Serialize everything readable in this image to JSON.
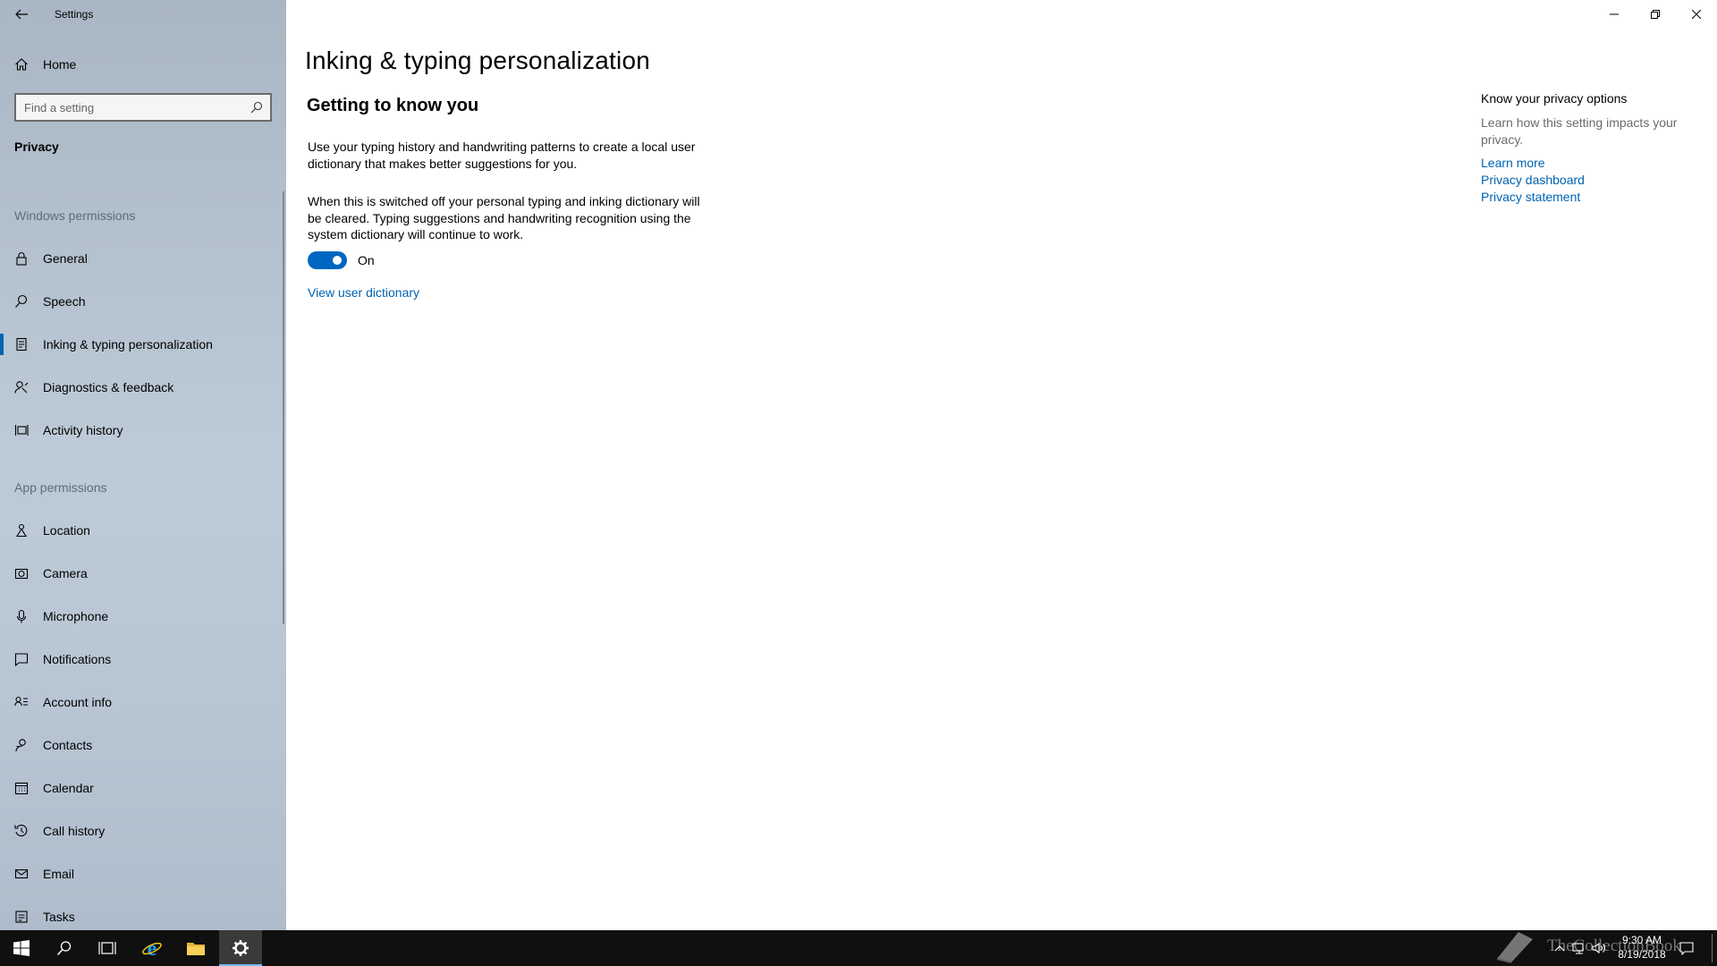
{
  "window": {
    "app_title": "Settings",
    "controls": [
      "minimize-icon",
      "restore-icon",
      "close-icon"
    ]
  },
  "sidebar": {
    "home_label": "Home",
    "search_placeholder": "Find a setting",
    "category": "Privacy",
    "windows_permissions_header": "Windows permissions",
    "windows_permissions": [
      {
        "label": "General",
        "icon": "lock-icon"
      },
      {
        "label": "Speech",
        "icon": "speech-icon"
      },
      {
        "label": "Inking & typing personalization",
        "icon": "inking-icon",
        "selected": true
      },
      {
        "label": "Diagnostics & feedback",
        "icon": "feedback-icon"
      },
      {
        "label": "Activity history",
        "icon": "activity-icon"
      }
    ],
    "app_permissions_header": "App permissions",
    "app_permissions": [
      {
        "label": "Location",
        "icon": "location-icon"
      },
      {
        "label": "Camera",
        "icon": "camera-icon"
      },
      {
        "label": "Microphone",
        "icon": "microphone-icon"
      },
      {
        "label": "Notifications",
        "icon": "notifications-icon"
      },
      {
        "label": "Account info",
        "icon": "account-info-icon"
      },
      {
        "label": "Contacts",
        "icon": "contacts-icon"
      },
      {
        "label": "Calendar",
        "icon": "calendar-icon"
      },
      {
        "label": "Call history",
        "icon": "call-history-icon"
      },
      {
        "label": "Email",
        "icon": "email-icon"
      },
      {
        "label": "Tasks",
        "icon": "tasks-icon"
      }
    ]
  },
  "main": {
    "title": "Inking & typing personalization",
    "section_title": "Getting to know you",
    "description": "Use your typing history and handwriting patterns to create a local user dictionary that makes better suggestions for you.",
    "switch_note": "When this is switched off your personal typing and inking dictionary will be cleared. Typing suggestions and handwriting recognition using the system dictionary will continue to work.",
    "toggle_state": "On",
    "toggle_on": true,
    "view_dictionary_link": "View user dictionary"
  },
  "right_panel": {
    "title": "Know your privacy options",
    "description": "Learn how this setting impacts your privacy.",
    "links": [
      "Learn more",
      "Privacy dashboard",
      "Privacy statement"
    ]
  },
  "taskbar": {
    "icons": [
      "windows-start-icon",
      "search-icon",
      "task-view-icon",
      "internet-explorer-icon",
      "file-explorer-icon",
      "settings-gear-icon"
    ],
    "active": "settings-gear-icon",
    "time": "9:30 AM",
    "date": "8/19/2018",
    "watermark": "TheCollectionBook"
  },
  "colors": {
    "accent": "#0063b1",
    "toggle_on": "#0067c0",
    "taskbar": "#101010"
  }
}
